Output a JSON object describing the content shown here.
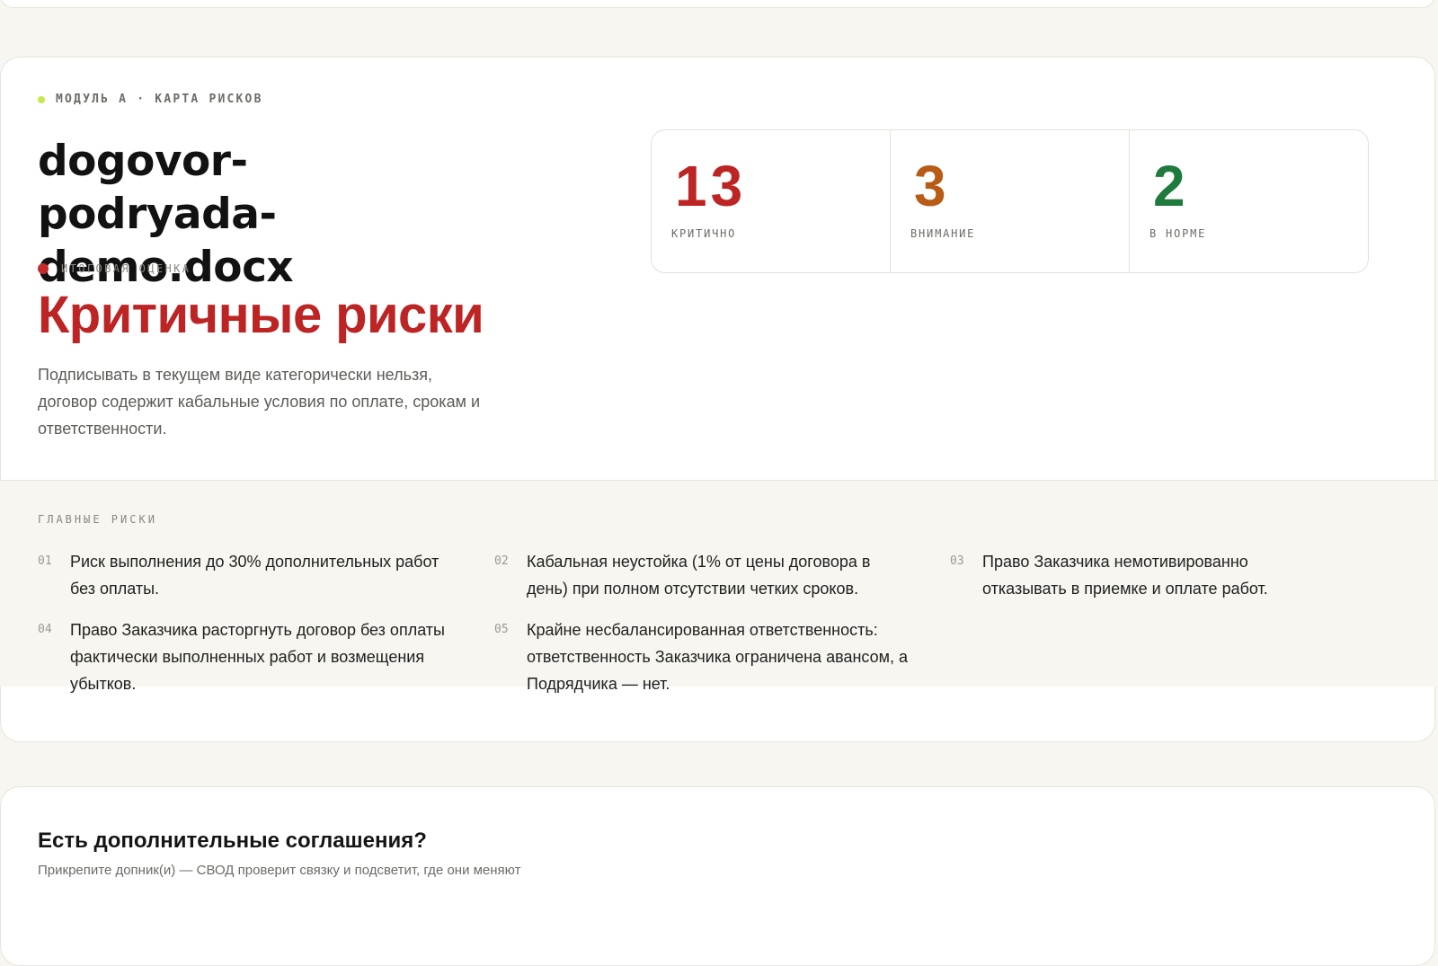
{
  "module": {
    "eyebrow": "МОДУЛЬ А · КАРТА РИСКОВ",
    "filename": "dogovor-podryada-demo.docx"
  },
  "verdict": {
    "label": "ИТОГОВАЯ ОЦЕНКА",
    "title": "Критичные риски",
    "description": "Подписывать в текущем виде категорически нельзя, договор содержит кабальные условия по оплате, срокам и ответственности.",
    "color": "#bd2424"
  },
  "stats": [
    {
      "value": "13",
      "label": "КРИТИЧНО",
      "color": "#bd2424"
    },
    {
      "value": "3",
      "label": "ВНИМАНИЕ",
      "color": "#b85b16"
    },
    {
      "value": "2",
      "label": "В НОРМЕ",
      "color": "#1f7a3d"
    }
  ],
  "main_risks": {
    "title": "ГЛАВНЫЕ РИСКИ",
    "items": [
      {
        "num": "01",
        "text": "Риск выполнения до 30% дополнительных работ без оплаты."
      },
      {
        "num": "02",
        "text": "Кабальная неустойка (1% от цены договора в день) при полном отсутствии четких сроков."
      },
      {
        "num": "03",
        "text": "Право Заказчика немотивированно отказывать в приемке и оплате работ."
      },
      {
        "num": "04",
        "text": "Право Заказчика расторгнуть договор без оплаты фактически выполненных работ и возмещения убытков."
      },
      {
        "num": "05",
        "text": "Крайне несбалансированная ответственность: ответственность Заказчика ограничена авансом, а Подрядчика — нет."
      }
    ]
  },
  "addendum": {
    "title": "Есть дополнительные соглашения?",
    "subtitle": "Прикрепите допник(и) — СВОД проверит связку и подсветит, где они меняют"
  }
}
